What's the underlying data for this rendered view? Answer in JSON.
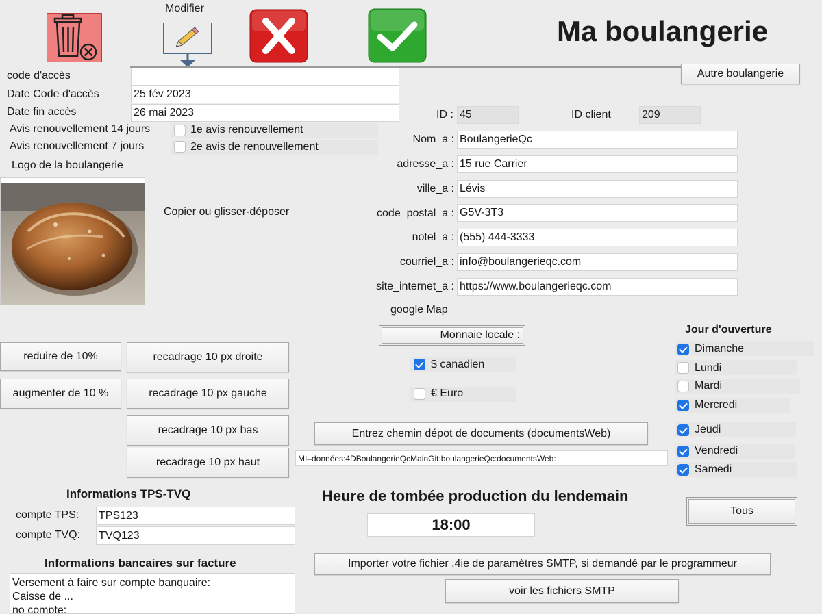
{
  "header": {
    "app_title": "Ma boulangerie",
    "modifier_label": "Modifier",
    "other_bakery_button": "Autre boulangerie"
  },
  "access": {
    "code_label": "code d'accès",
    "code_value": "",
    "date_code_label": "Date Code d'accès",
    "date_code_value": "25 fév 2023",
    "date_end_label": "Date fin accès",
    "date_end_value": "26 mai 2023",
    "notice14_label": "Avis renouvellement 14 jours",
    "notice14_check_label": "1e avis renouvellement",
    "notice14_checked": false,
    "notice7_label": "Avis renouvellement 7 jours",
    "notice7_check_label": "2e avis de renouvellement",
    "notice7_checked": false
  },
  "logo": {
    "label": "Logo de la boulangerie",
    "drop_hint": "Copier ou glisser-déposer"
  },
  "image_tools": {
    "reduce": "reduire de 10%",
    "enlarge": "augmenter de 10 %",
    "crop_right": "recadrage 10 px droite",
    "crop_left": "recadrage 10 px gauche",
    "crop_bottom": "recadrage 10 px bas",
    "crop_top": "recadrage 10 px haut"
  },
  "bakery": {
    "id_label": "ID :",
    "id_value": "45",
    "client_label": "ID client",
    "client_value": "209",
    "name_label": "Nom_a :",
    "name_value": "BoulangerieQc",
    "address_label": "adresse_a :",
    "address_value": "15 rue Carrier",
    "city_label": "ville_a :",
    "city_value": "Lévis",
    "postal_label": "code_postal_a :",
    "postal_value": "G5V-3T3",
    "phone_label": "notel_a :",
    "phone_value": "(555) 444-3333",
    "email_label": "courriel_a :",
    "email_value": "info@boulangerieqc.com",
    "site_label": "site_internet_a :",
    "site_value": "https://www.boulangerieqc.com",
    "google_map": "google Map"
  },
  "currency": {
    "button": "Monnaie locale :",
    "cad_label": "$ canadien",
    "cad_checked": true,
    "eur_label": "€ Euro",
    "eur_checked": false
  },
  "documents": {
    "button": "Entrez chemin dépot de documents (documentsWeb)",
    "path": "MI–données:4DBoulangerieQcMainGit:boulangerieQc:documentsWeb:"
  },
  "opening_days": {
    "title": "Jour d'ouverture",
    "days": [
      {
        "label": "Dimanche",
        "checked": true
      },
      {
        "label": "Lundi",
        "checked": false
      },
      {
        "label": "Mardi",
        "checked": false
      },
      {
        "label": "Mercredi",
        "checked": true
      },
      {
        "label": "Jeudi",
        "checked": true
      },
      {
        "label": "Vendredi",
        "checked": true
      },
      {
        "label": "Samedi",
        "checked": true
      }
    ],
    "all_button": "Tous"
  },
  "production": {
    "title": "Heure de tombée production du lendemain",
    "time": "18:00"
  },
  "taxes": {
    "title": "Informations TPS-TVQ",
    "tps_label": "compte TPS:",
    "tps_value": "TPS123",
    "tvq_label": "compte TVQ:",
    "tvq_value": "TVQ123"
  },
  "banking": {
    "title": "Informations bancaires sur facture",
    "line1": "Versement à faire sur compte banquaire:",
    "line2": "Caisse de ...",
    "line3": "no compte:"
  },
  "smtp": {
    "import_button": "Importer votre fichier .4ie de paramètres SMTP, si demandé par le programmeur",
    "view_button": "voir les  fichiers SMTP"
  },
  "colors": {
    "trash_red": "#f08080",
    "cancel_red": "#d71f1f",
    "ok_green": "#2fa82f",
    "checkbox_blue": "#1f75e6"
  }
}
